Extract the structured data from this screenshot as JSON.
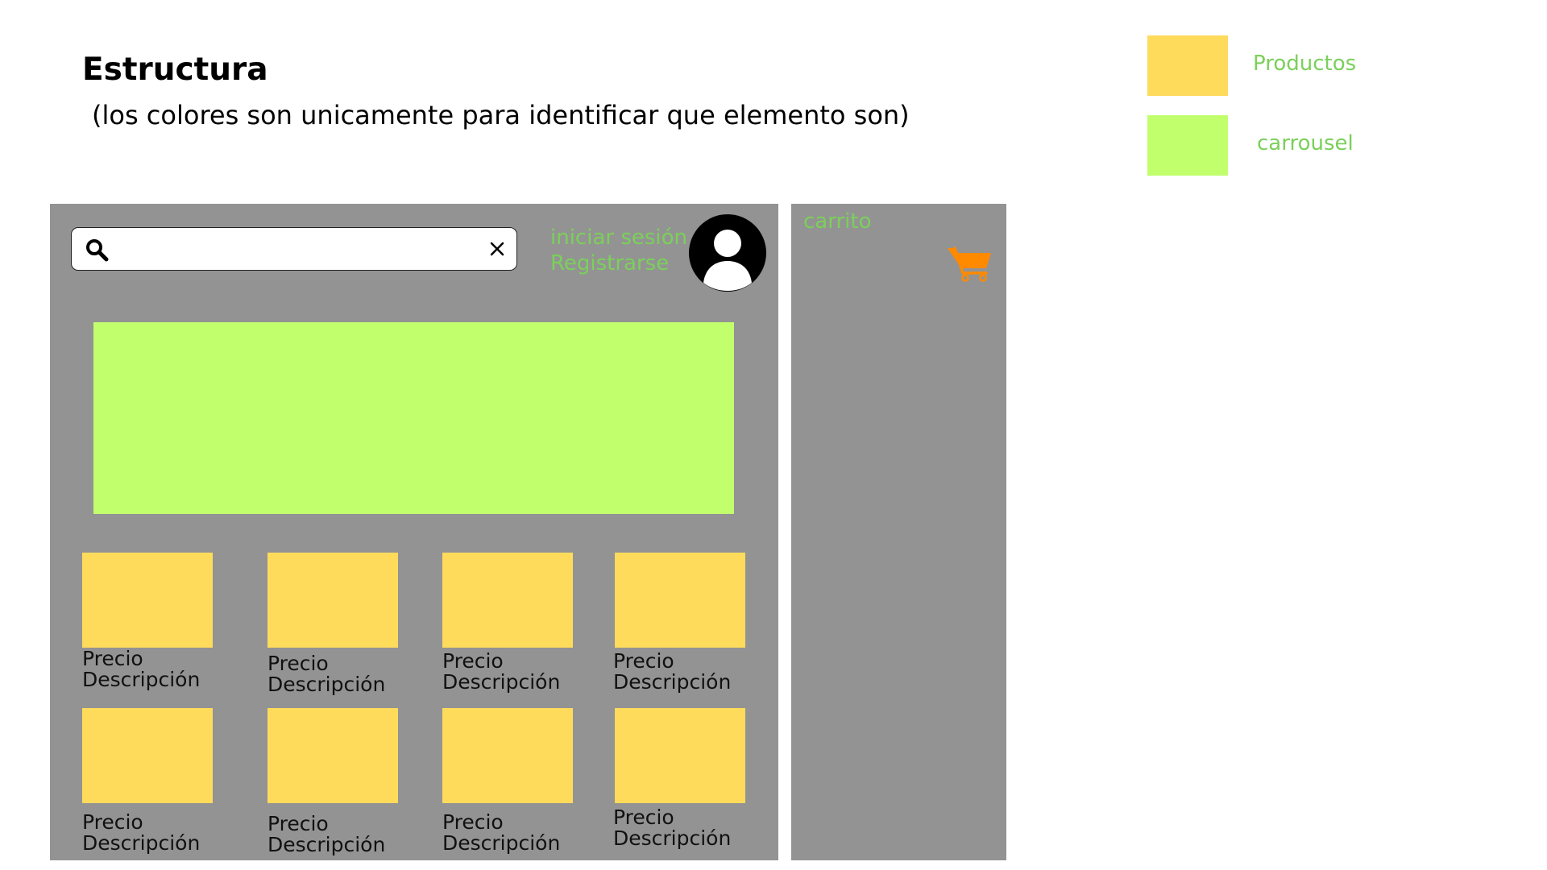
{
  "header": {
    "title": "Estructura",
    "subtitle": "(los colores son unicamente para identificar que elemento son)"
  },
  "legend": {
    "items": [
      {
        "label": "Productos",
        "color": "#FFDB5C"
      },
      {
        "label": "carrousel",
        "color": "#C1FF6D"
      }
    ],
    "label_color": "#7BD05A"
  },
  "main": {
    "panel_color": "#939393",
    "search": {
      "value": "",
      "placeholder": "",
      "icon": "search-icon",
      "clear_icon": "close-icon"
    },
    "auth": {
      "login": "iniciar sesión",
      "register": "Registrarse",
      "color": "#7BD05A"
    },
    "avatar": {
      "icon": "user-avatar-icon"
    },
    "carousel": {
      "color": "#C1FF6D"
    },
    "products": [
      {
        "price": "Precio",
        "description": "Descripción"
      },
      {
        "price": "Precio",
        "description": "Descripción"
      },
      {
        "price": "Precio",
        "description": "Descripción"
      },
      {
        "price": "Precio",
        "description": "Descripción"
      },
      {
        "price": "Precio",
        "description": "Descripción"
      },
      {
        "price": "Precio",
        "description": "Descripción"
      },
      {
        "price": "Precio",
        "description": "Descripción"
      },
      {
        "price": "Precio",
        "description": "Descripción"
      }
    ],
    "product_color": "#FFDB5C"
  },
  "cart": {
    "label": "carrito",
    "icon": "shopping-cart-icon",
    "icon_color": "#FF8A00"
  }
}
